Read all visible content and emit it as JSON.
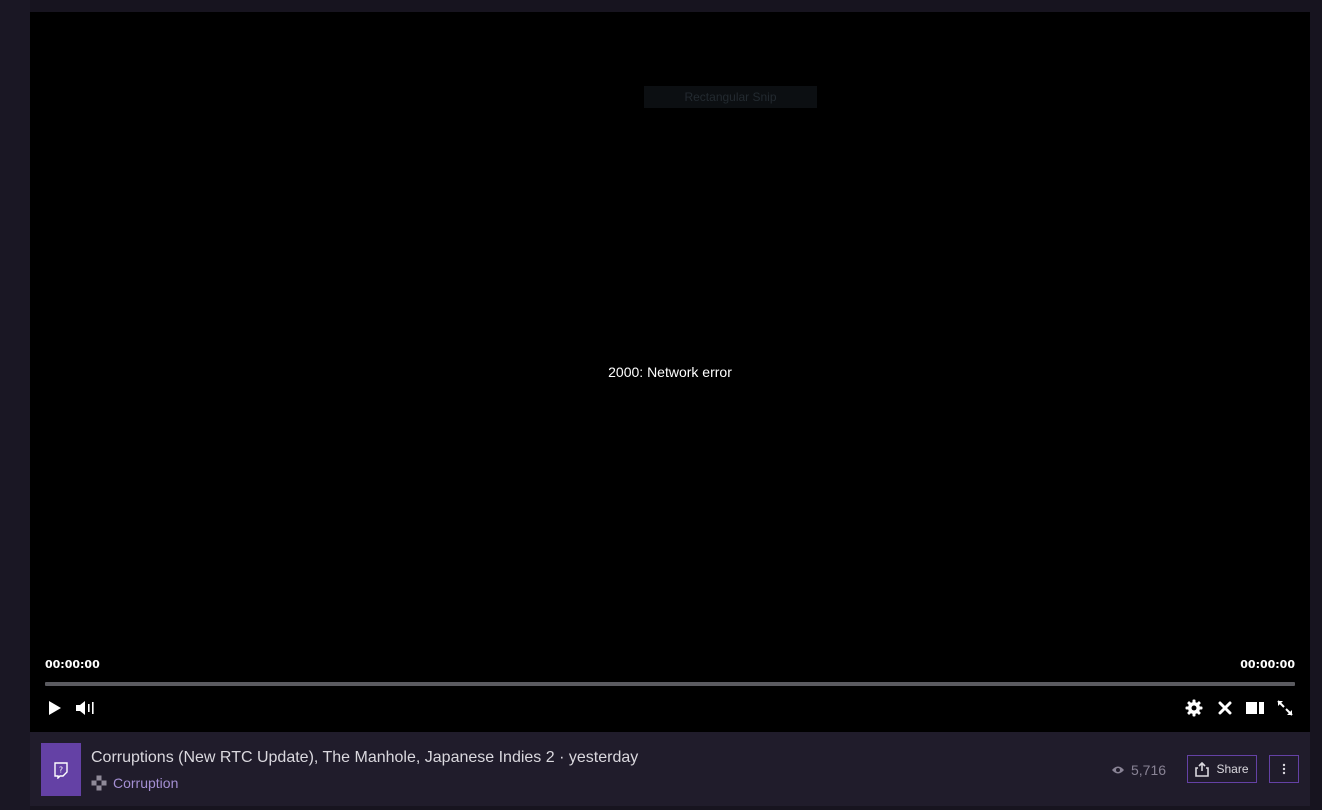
{
  "player": {
    "overlay_text": "Rectangular Snip",
    "error_message": "2000: Network error",
    "time_elapsed": "00:00:00",
    "time_total": "00:00:00",
    "progress": 0,
    "controls": {
      "play_icon": "play-icon",
      "volume_icon": "volume-icon",
      "settings_icon": "gear-icon",
      "close_icon": "close-icon",
      "theatre_icon": "theatre-mode-icon",
      "fullscreen_icon": "fullscreen-icon"
    }
  },
  "video_info": {
    "title": "Corruptions (New RTC Update), The Manhole, Japanese Indies 2 · yesterday",
    "game": "Corruption",
    "views": "5,716",
    "share_label": "Share"
  },
  "colors": {
    "accent": "#6441a5",
    "game_link": "#a48fd3",
    "info_bg": "#201c2b",
    "player_bg": "#000000"
  }
}
